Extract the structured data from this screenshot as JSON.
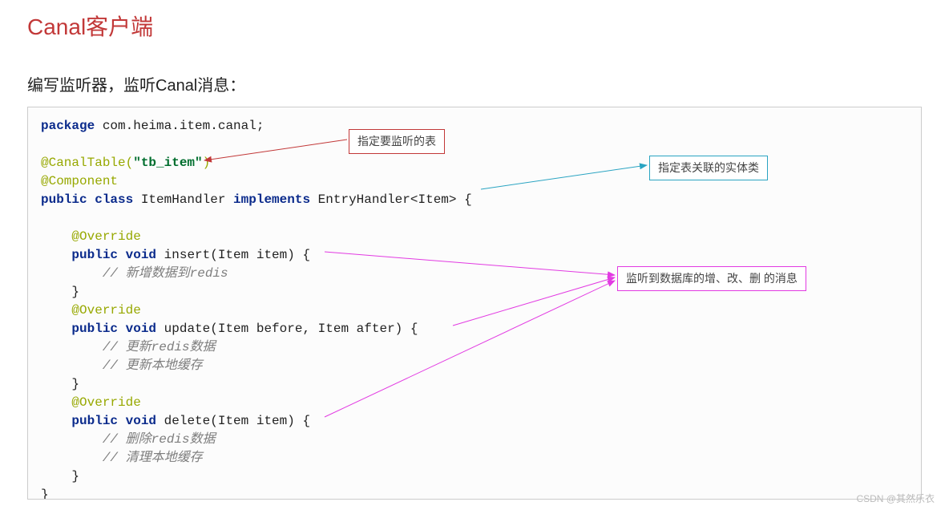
{
  "title": "Canal客户端",
  "subtitle": "编写监听器，监听Canal消息：",
  "labels": {
    "red": "指定要监听的表",
    "cyan": "指定表关联的实体类",
    "magenta": "监听到数据库的增、改、删  的消息"
  },
  "code": {
    "l1_kw": "package",
    "l1_rest": " com.heima.item.canal;",
    "l3_ann": "@CanalTable(",
    "l3_str": "\"tb_item\"",
    "l3_end": ")",
    "l4_ann": "@Component",
    "l5_kw1": "public class",
    "l5_name": " ItemHandler ",
    "l5_kw2": "implements",
    "l5_rest": " EntryHandler<Item> {",
    "l7_ann": "    @Override",
    "l8_kw": "    public void",
    "l8_rest": " insert(Item item) {",
    "l9_cmt": "        // 新增数据到redis",
    "l10": "    }",
    "l11_ann": "    @Override",
    "l12_kw": "    public void",
    "l12_rest": " update(Item before, Item after) {",
    "l13_cmt": "        // 更新redis数据",
    "l14_cmt": "        // 更新本地缓存",
    "l15": "    }",
    "l16_ann": "    @Override",
    "l17_kw": "    public void",
    "l17_rest": " delete(Item item) {",
    "l18_cmt": "        // 删除redis数据",
    "l19_cmt": "        // 清理本地缓存",
    "l20": "    }",
    "l21": "}"
  },
  "watermark": "CSDN @其然乐衣"
}
